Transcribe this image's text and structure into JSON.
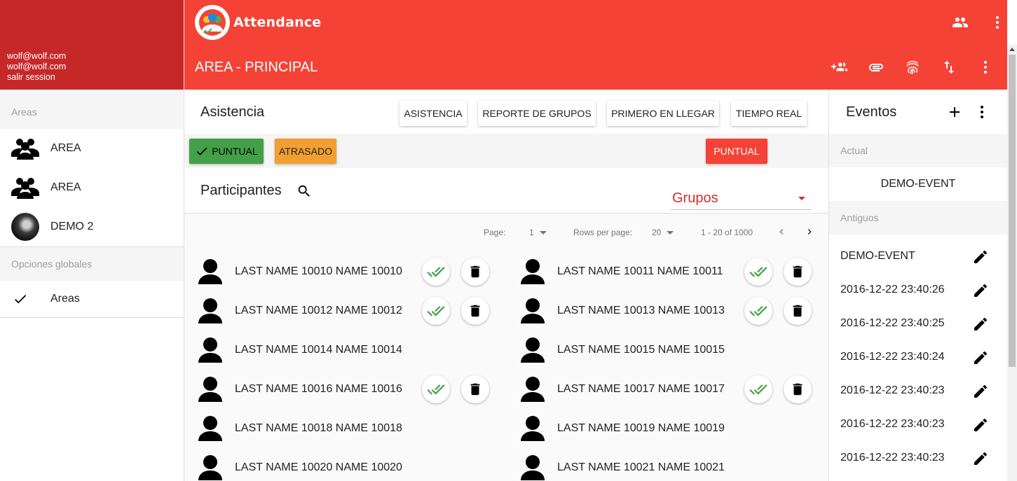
{
  "app": {
    "name": "Attendance"
  },
  "user": {
    "email": "wolf@wolf.com",
    "name": "wolf@wolf.com",
    "logout": "salir session"
  },
  "sidebar": {
    "areas_header": "Areas",
    "areas": [
      {
        "label": "AREA",
        "icon": "group-icon"
      },
      {
        "label": "AREA",
        "icon": "group-icon"
      },
      {
        "label": "DEMO 2",
        "icon": "avatar"
      }
    ],
    "global_header": "Opciones globales",
    "global_items": [
      {
        "label": "Areas",
        "icon": "check-icon"
      }
    ]
  },
  "header": {
    "area_title": "AREA - PRINCIPAL",
    "top_icons": [
      "people-icon",
      "more-vert-icon"
    ],
    "actions": [
      "add-group-icon",
      "attachment-icon",
      "fingerprint-icon",
      "import-export-icon",
      "more-vert-icon"
    ]
  },
  "asistencia": {
    "title": "Asistencia",
    "buttons": [
      "ASISTENCIA",
      "REPORTE DE GRUPOS",
      "PRIMERO EN LLEGAR",
      "TIEMPO REAL"
    ]
  },
  "status": {
    "puntual": "PUNTUAL",
    "atrasado": "ATRASADO",
    "current": "PUNTUAL",
    "colors": {
      "puntual": "#43a047",
      "atrasado": "#f0a030",
      "current": "#f44336"
    }
  },
  "participantes": {
    "title": "Participantes",
    "group_select": "Grupos",
    "pagination": {
      "page_label": "Page:",
      "page": "1",
      "rows_label": "Rows per page:",
      "rows": "20",
      "range": "1 - 20 of 1000"
    },
    "items": [
      {
        "name": "LAST NAME 10010 NAME 10010",
        "actions": true
      },
      {
        "name": "LAST NAME 10011 NAME 10011",
        "actions": true
      },
      {
        "name": "LAST NAME 10012 NAME 10012",
        "actions": true
      },
      {
        "name": "LAST NAME 10013 NAME 10013",
        "actions": true
      },
      {
        "name": "LAST NAME 10014 NAME 10014",
        "actions": false
      },
      {
        "name": "LAST NAME 10015 NAME 10015",
        "actions": false
      },
      {
        "name": "LAST NAME 10016 NAME 10016",
        "actions": true
      },
      {
        "name": "LAST NAME 10017 NAME 10017",
        "actions": true
      },
      {
        "name": "LAST NAME 10018 NAME 10018",
        "actions": false
      },
      {
        "name": "LAST NAME 10019 NAME 10019",
        "actions": false
      },
      {
        "name": "LAST NAME 10020 NAME 10020",
        "actions": false
      },
      {
        "name": "LAST NAME 10021 NAME 10021",
        "actions": false
      }
    ]
  },
  "events": {
    "title": "Eventos",
    "current_header": "Actual",
    "current": "DEMO-EVENT",
    "past_header": "Antiguos",
    "past": [
      "DEMO-EVENT",
      "2016-12-22 23:40:26",
      "2016-12-22 23:40:25",
      "2016-12-22 23:40:24",
      "2016-12-22 23:40:23",
      "2016-12-22 23:40:23",
      "2016-12-22 23:40:23"
    ]
  },
  "colors": {
    "primary": "#f44336",
    "primary_dark": "#c62828",
    "accent": "#d32f2f",
    "done_check": "#43a047"
  }
}
